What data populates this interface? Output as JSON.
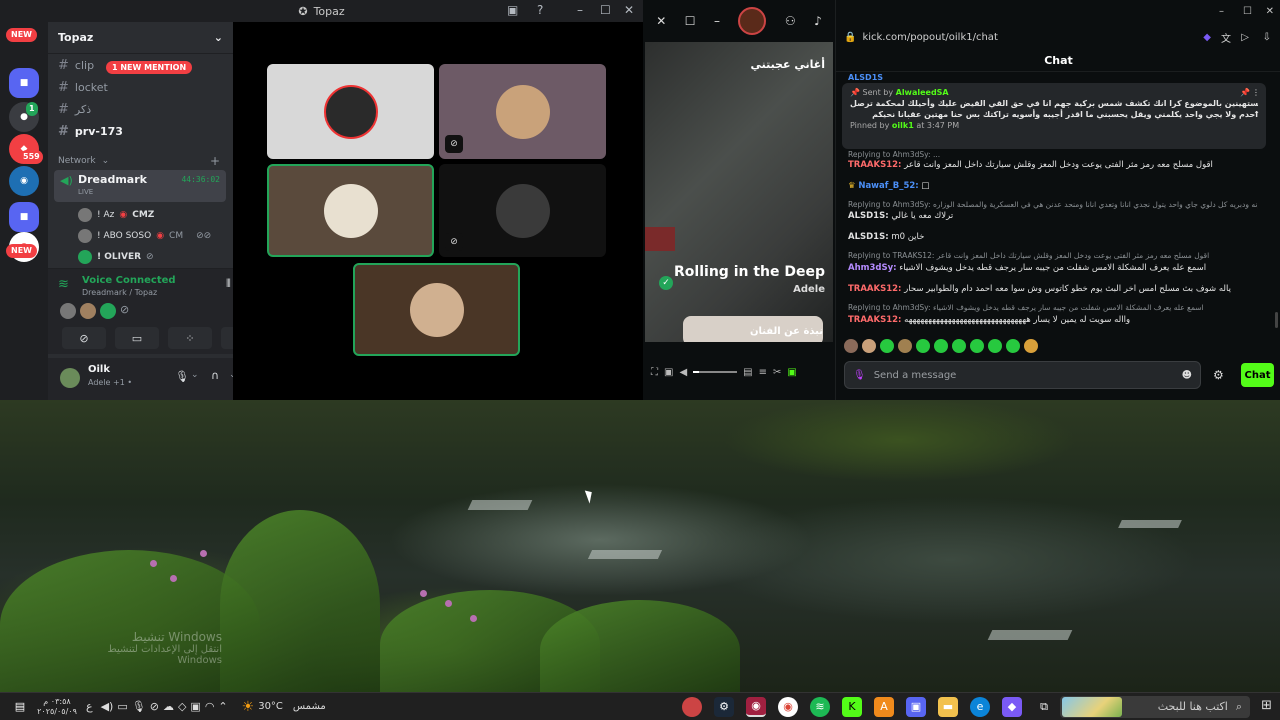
{
  "discord": {
    "window_title": "Topaz",
    "server_name": "Topaz",
    "guild_badges": {
      "new_top": "NEW",
      "new_bottom": "NEW",
      "count_1": "1",
      "count_559": "559"
    },
    "channels": [
      {
        "name": "clip"
      },
      {
        "name": "locket"
      },
      {
        "name": "ذكر"
      },
      {
        "name": "prv-173"
      }
    ],
    "mention_pill": "1 NEW MENTION",
    "category": "Network",
    "voice_channel": {
      "name": "Dreadmark",
      "timer": "44:36:02",
      "live": "LIVE"
    },
    "members": [
      {
        "name": "! Az",
        "tag": "CMZ"
      },
      {
        "name": "! ABO SOSO",
        "tag": "CM"
      },
      {
        "name": "! OLIVER",
        "tag": ""
      }
    ],
    "voice_status": {
      "title": "Voice Connected",
      "subtitle": "Dreadmark / Topaz"
    },
    "user": {
      "name": "Oilk",
      "status": "Adele +1 •"
    }
  },
  "kick": {
    "video_caption_ar": "أغاني عجبتني",
    "song_title": "Rolling in the Deep",
    "artist": "Adele",
    "about_artist_ar": "نبذة عن الفنان"
  },
  "chat": {
    "url": "kick.com/popout/oilk1/chat",
    "title": "Chat",
    "top_user": "ALSD1S",
    "pinned": {
      "sent_by_label": "Sent by",
      "sent_by_user": "AlwaleedSA",
      "text_line1": "يلغزان أكثر راقه مستهينين بالموضوع كرا انك تكشف شمس بركية جهم انا في حق القي القيض عليك وأحيلك لمحكمة ترصل",
      "text_line2": "احدم ولا يجي واحد يكلمني ويقل يحسبني ما اقدر أجيبه وأسويه تراكتك بس حنا مهتين عقبانا نحيكم",
      "pinned_by_label": "Pinned by",
      "pinned_by_user": "oilk1",
      "pinned_time": "at 3:47 PM"
    },
    "messages": [
      {
        "type": "reply",
        "text": "Replying to Ahm3dSy: ..."
      },
      {
        "type": "msg",
        "user": "TRAAKS12:",
        "color": "red",
        "text": "اقول مسلح معه رمز مثر الفتى يوعت ودخل المعز وقلش سيارتك داخل المعز وانت قاعر"
      },
      {
        "type": "msg",
        "user": "Nawaf_B_52:",
        "color": "blue",
        "text": "□"
      },
      {
        "type": "reply",
        "text": "Replying to Ahm3dSy: الدليل إنه ودبريه كل دلوي جاي واحد يتول نجدي انانا وتعدي انانا ومنحد عدنن هي في العسكرية والمصلحة الوزاره"
      },
      {
        "type": "msg",
        "user": "ALSD1S:",
        "color": "white",
        "text": "ترلاك معه يا غالي"
      },
      {
        "type": "msg",
        "user": "ALSD1S:",
        "color": "white",
        "text": "m0 خاين"
      },
      {
        "type": "reply",
        "text": "Replying to TRAAKS12: اقول مسلح معه رمز مثر الفتى يوعت ودخل المعز وقلش سيارتك داخل المعز وانت قاعر"
      },
      {
        "type": "msg",
        "user": "Ahm3dSy:",
        "color": "purple",
        "text": "اسمع عله يعرف المشكلة الامس شفلت من جيبه سار يرجف قطه يدخل ويشوف الاشياء"
      },
      {
        "type": "msg",
        "user": "TRAAKS12:",
        "color": "red",
        "text": "ياله شوف بث مسلح امس اخر البث يوم خطو كاتوس وش سوا معه احمد دام والطوابير سحار"
      },
      {
        "type": "reply",
        "text": "Replying to Ahm3dSy: اسمع عله يعرف المشكلة الامس شفلت من جيبه سار يرجف قطه يدخل ويشوف الاشياء"
      },
      {
        "type": "msg",
        "user": "TRAAKS12:",
        "color": "red",
        "text": "وااله سويت له يمين لا يسار هههههههههههههههههههههههههههههههه"
      }
    ],
    "send_placeholder": "Send a message",
    "chat_button": "Chat"
  },
  "desktop": {
    "watermark_line1": "تنشيط Windows",
    "watermark_line2": "انتقل إلى الإعدادات لتنشيط Windows"
  },
  "taskbar": {
    "time": "٠٣:٥٨ م",
    "date": "٢٠٢٥/٠٥/٠٩",
    "lang": "ع",
    "weather_temp": "30°C",
    "weather_text": "مشمس",
    "search_placeholder": "اكتب هنا للبحث"
  },
  "colors": {
    "kick_green": "#53fc18",
    "discord_bg": "#2b2d31",
    "discord_red": "#f23f43"
  }
}
